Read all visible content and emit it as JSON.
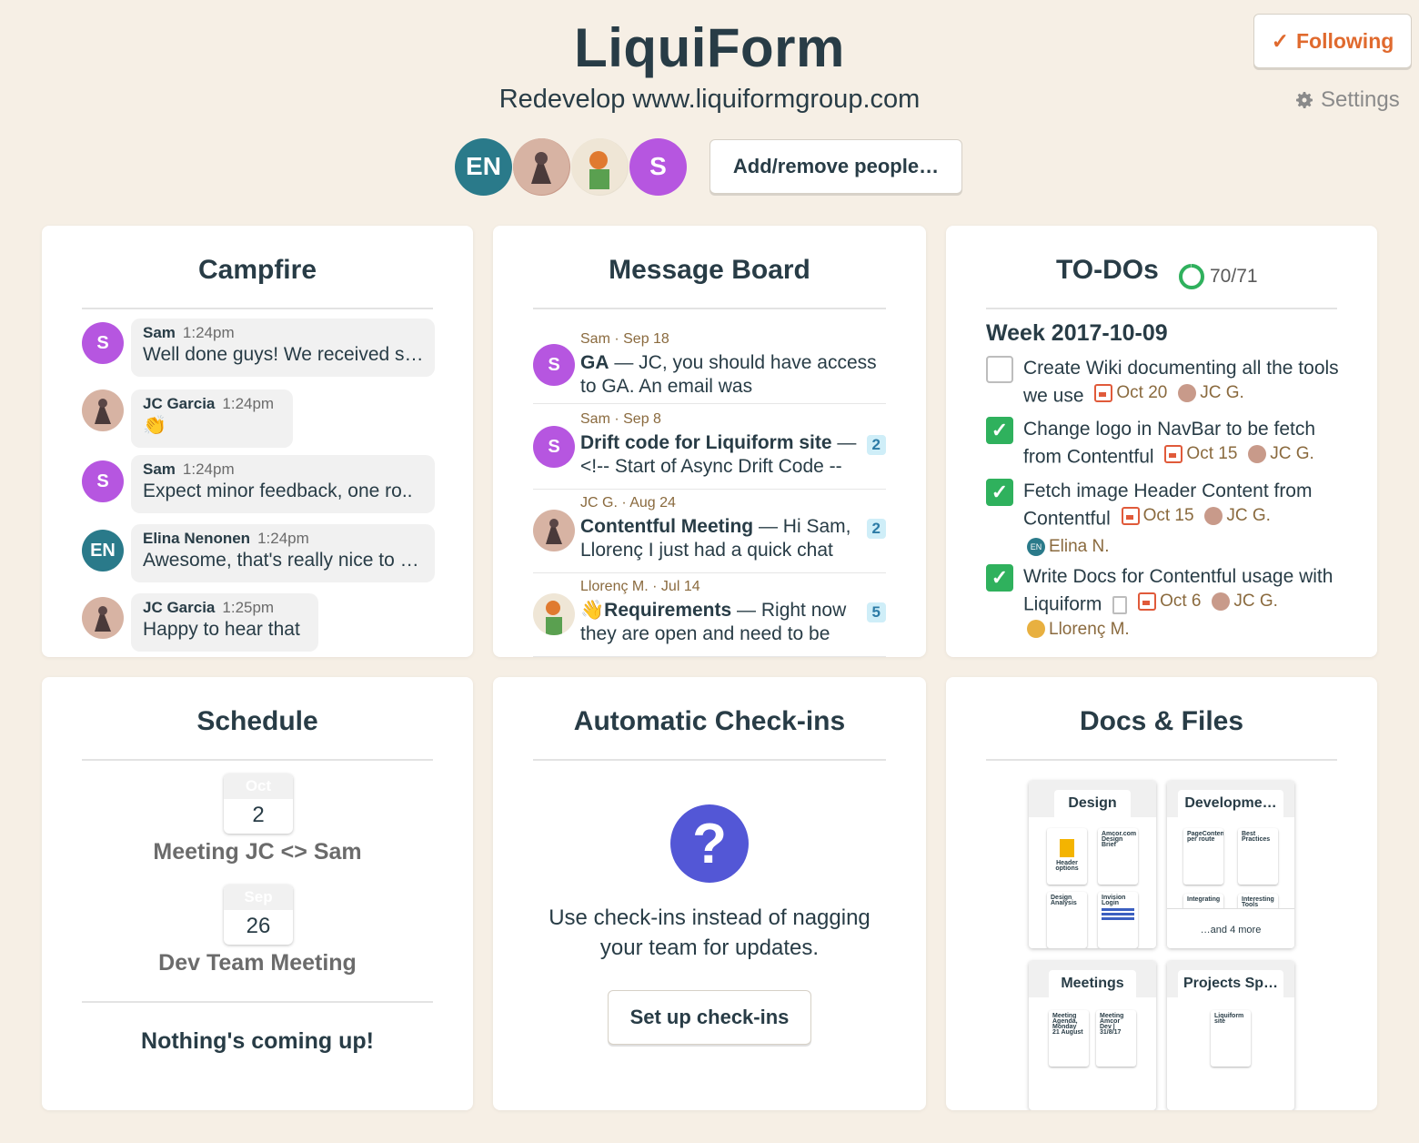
{
  "header": {
    "title": "LiquiForm",
    "description": "Redevelop www.liquiformgroup.com",
    "add_people_label": "Add/remove people…",
    "following_label": "Following",
    "settings_label": "Settings",
    "people": [
      {
        "initials": "EN",
        "color": "#2a7a8a"
      },
      {
        "initials": "",
        "color": "#c89a8a"
      },
      {
        "initials": "",
        "color": "#e8e0d0"
      },
      {
        "initials": "S",
        "color": "#b656e0"
      }
    ]
  },
  "campfire": {
    "title": "Campfire",
    "lines": [
      {
        "initials": "S",
        "color": "#b656e0",
        "name": "Sam",
        "time": "1:24pm",
        "text": "Well done guys! We received s…"
      },
      {
        "initials": "",
        "color": "#c89a8a",
        "name": "JC Garcia",
        "time": "1:24pm",
        "text": "👏"
      },
      {
        "initials": "S",
        "color": "#b656e0",
        "name": "Sam",
        "time": "1:24pm",
        "text": "Expect minor feedback, one ro.."
      },
      {
        "initials": "EN",
        "color": "#2a7a8a",
        "name": "Elina Nenonen",
        "time": "1:24pm",
        "text": "Awesome, that's really nice to …"
      },
      {
        "initials": "",
        "color": "#c89a8a",
        "name": "JC Garcia",
        "time": "1:25pm",
        "text": "Happy to hear that"
      }
    ]
  },
  "message_board": {
    "title": "Message Board",
    "messages": [
      {
        "initials": "S",
        "color": "#b656e0",
        "meta": "Sam · Sep 18",
        "subject": "GA",
        "excerpt": " — JC, you should have access to GA.  An email was",
        "count": ""
      },
      {
        "initials": "S",
        "color": "#b656e0",
        "meta": "Sam · Sep 8",
        "subject": "Drift code for Liquiform site",
        "excerpt": " — <!-- Start of Async Drift Code --",
        "count": "2"
      },
      {
        "initials": "",
        "color": "#c89a8a",
        "meta": "JC G. · Aug 24",
        "subject": "Contentful Meeting",
        "excerpt": " — Hi Sam, Llorenç  I just had a quick chat",
        "count": "2"
      },
      {
        "initials": "",
        "color": "#e8b040",
        "meta": "Llorenç M. · Jul 14",
        "subject": "👋Requirements",
        "excerpt": " — Right now they are open and need to be",
        "count": "5"
      }
    ]
  },
  "todos": {
    "title": "TO-DOs",
    "progress": "70/71",
    "progress_fraction": 0.986,
    "group": "Week 2017-10-09",
    "items": [
      {
        "done": false,
        "text": "Create Wiki documenting all the tools we use",
        "date": "Oct 20",
        "assignee": "JC G.",
        "extra": ""
      },
      {
        "done": true,
        "text": "Change logo in NavBar to be fetch from Contentful",
        "date": "Oct 15",
        "assignee": "JC G.",
        "extra": ""
      },
      {
        "done": true,
        "text": "Fetch image Header Content from Contentful",
        "date": "Oct 15",
        "assignee": "JC G.",
        "extra": "Elina N."
      },
      {
        "done": true,
        "text": "Write Docs for Contentful usage with Liquiform",
        "date": "Oct 6",
        "assignee": "JC G.",
        "extra": "Llorenç M."
      }
    ]
  },
  "schedule": {
    "title": "Schedule",
    "events": [
      {
        "month": "Oct",
        "day": "2",
        "title": "Meeting JC <> Sam"
      },
      {
        "month": "Sep",
        "day": "26",
        "title": "Dev Team Meeting"
      }
    ],
    "empty_text": "Nothing's coming up!"
  },
  "checkins": {
    "title": "Automatic Check-ins",
    "icon": "?",
    "text": "Use check-ins instead of nagging your team for updates.",
    "button_label": "Set up check-ins"
  },
  "docs": {
    "title": "Docs & Files",
    "folders": [
      {
        "name": "Design",
        "docs": [
          "Header options",
          "Amcor.com Design Brief",
          "Design Analysis",
          "Invision Login"
        ]
      },
      {
        "name": "Developme…",
        "docs": [
          "PageContent per route",
          "Best Practices",
          "Integrating",
          "Interesting Tools"
        ],
        "more": "…and 4 more"
      },
      {
        "name": "Meetings",
        "docs": [
          "Meeting Agenda, Monday 21 August",
          "Meeting Amcor Dev | 31/8/17"
        ]
      },
      {
        "name": "Projects Sp…",
        "docs": [
          "Liquiform site"
        ]
      }
    ]
  }
}
